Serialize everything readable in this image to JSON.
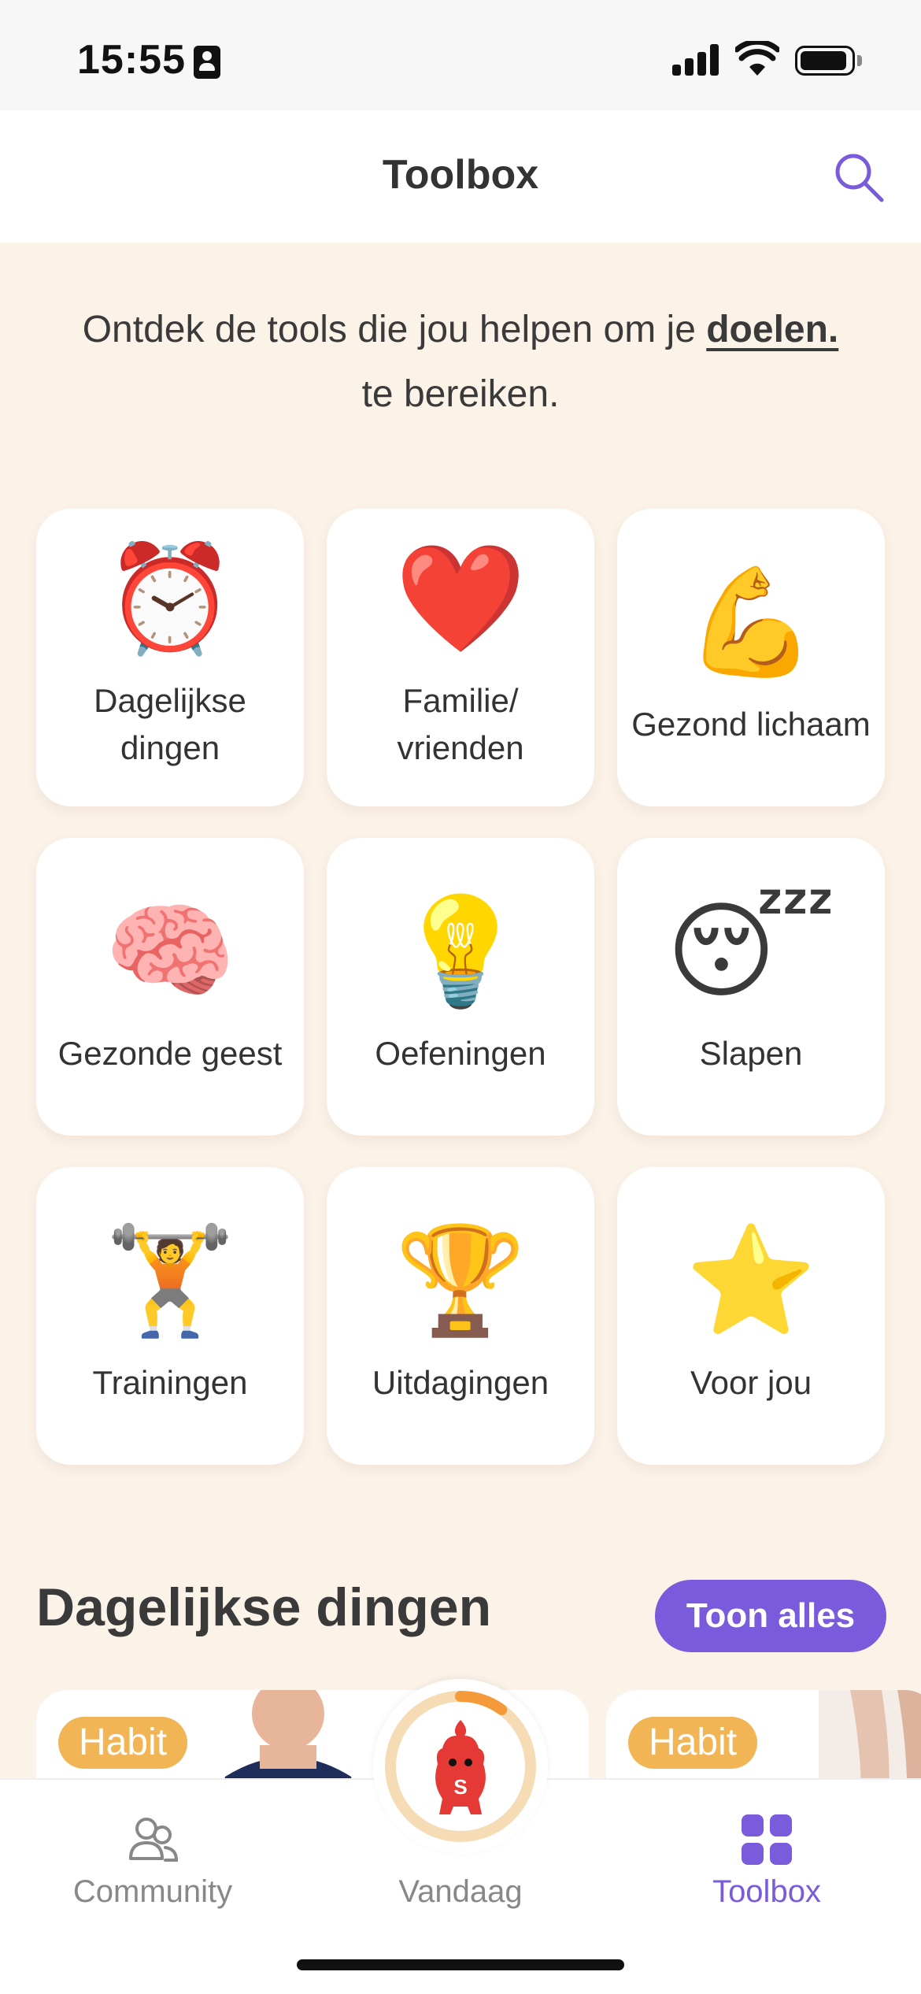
{
  "status_bar": {
    "time": "15:55",
    "icons": [
      "contact-card-icon",
      "cellular-signal-icon",
      "wifi-icon",
      "battery-icon"
    ]
  },
  "header": {
    "title": "Toolbox",
    "search_icon": "search-icon"
  },
  "intro": {
    "text_before": "Ontdek de tools die jou helpen om je ",
    "link_text": "doelen.",
    "text_after": "te bereiken."
  },
  "categories": [
    {
      "emoji": "⏰",
      "label_line1": "Dagelijkse",
      "label_line2": "dingen"
    },
    {
      "emoji": "❤️",
      "label_line1": "Familie/",
      "label_line2": "vrienden"
    },
    {
      "emoji": "💪",
      "label": "Gezond lichaam"
    },
    {
      "emoji": "🧠",
      "label": "Gezonde geest"
    },
    {
      "emoji": "💡",
      "label": "Oefeningen"
    },
    {
      "emoji": "😴",
      "label": "Slapen"
    },
    {
      "emoji": "🏋️",
      "label": "Trainingen"
    },
    {
      "emoji": "🏆",
      "label": "Uitdagingen"
    },
    {
      "emoji": "⭐",
      "label": "Voor jou"
    }
  ],
  "section": {
    "title": "Dagelijkse dingen",
    "show_all_label": "Toon alles",
    "cards": [
      {
        "badge": "Habit"
      },
      {
        "badge": "Habit"
      }
    ]
  },
  "tab_bar": {
    "tabs": [
      {
        "label": "Community",
        "icon": "community-icon",
        "active": false
      },
      {
        "label": "Vandaag",
        "icon": "mascot-icon",
        "active": false
      },
      {
        "label": "Toolbox",
        "icon": "toolbox-grid-icon",
        "active": true
      }
    ],
    "center_progress": 0.1
  },
  "colors": {
    "accent": "#7a5bdc",
    "background": "#fbf2e8",
    "badge": "#f1b556",
    "ring": "#f6dcb5",
    "ring_progress": "#f59a3a",
    "mascot": "#e53935"
  }
}
